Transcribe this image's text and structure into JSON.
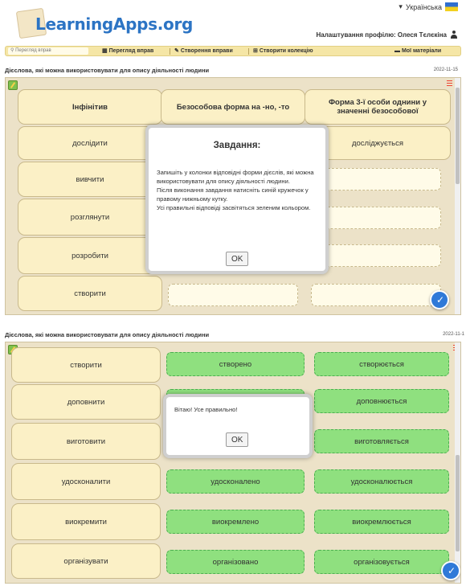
{
  "header": {
    "logo_text": "LearningApps.org",
    "language": "Українська",
    "profile": "Налаштування профілю: Олеся Тєлєкіна"
  },
  "nav": {
    "search_placeholder": "Перегляд вправ",
    "items": [
      "Перегляд вправ",
      "Створення вправи",
      "Створити колекцію",
      "Мої матеріали"
    ]
  },
  "exercise_title": "Дієслова, які можна використовувати для опису діяльності людини",
  "top": {
    "date": "2022-11-15",
    "headers": [
      "Інфінітив",
      "Безособова форма на -но, -то",
      "Форма 3-ї особи однини у значенні безособової"
    ],
    "rows": [
      {
        "infinitive": "дослідити",
        "form2": "",
        "form3": "досліджується"
      },
      {
        "infinitive": "вивчити",
        "form2": "",
        "form3": ""
      },
      {
        "infinitive": "розглянути",
        "form2": "",
        "form3": ""
      },
      {
        "infinitive": "розробити",
        "form2": "",
        "form3": ""
      },
      {
        "infinitive": "створити",
        "form2": "",
        "form3": ""
      }
    ],
    "dialog": {
      "title": "Завдання:",
      "text": "Запишіть у колонки відповідні форми дієслів, які можна використовувати для опису діяльності людини.\nПісля виконання завдання натисніть синій кружечок у правому нижньому кутку.\nУсі правильні відповіді засвітяться зеленим кольором.",
      "ok": "OK"
    }
  },
  "bottom": {
    "date": "2022-11-1",
    "rows": [
      {
        "infinitive": "створити",
        "form2": "створено",
        "form3": "створюється"
      },
      {
        "infinitive": "доповнити",
        "form2": "",
        "form3": "доповнюється"
      },
      {
        "infinitive": "виготовити",
        "form2": "",
        "form3": "виготовляється"
      },
      {
        "infinitive": "удосконалити",
        "form2": "удосконалено",
        "form3": "удосконалюється"
      },
      {
        "infinitive": "виокремити",
        "form2": "виокремлено",
        "form3": "виокремлюється"
      },
      {
        "infinitive": "організувати",
        "form2": "організовано",
        "form3": "організовується"
      }
    ],
    "dialog": {
      "text": "Вітаю! Усе правильно!",
      "ok": "OK"
    }
  },
  "colors": {
    "correct": "#8fe07f",
    "cell": "#fbf0c6",
    "accent": "#2f79d8",
    "logo": "#2c74c4"
  }
}
